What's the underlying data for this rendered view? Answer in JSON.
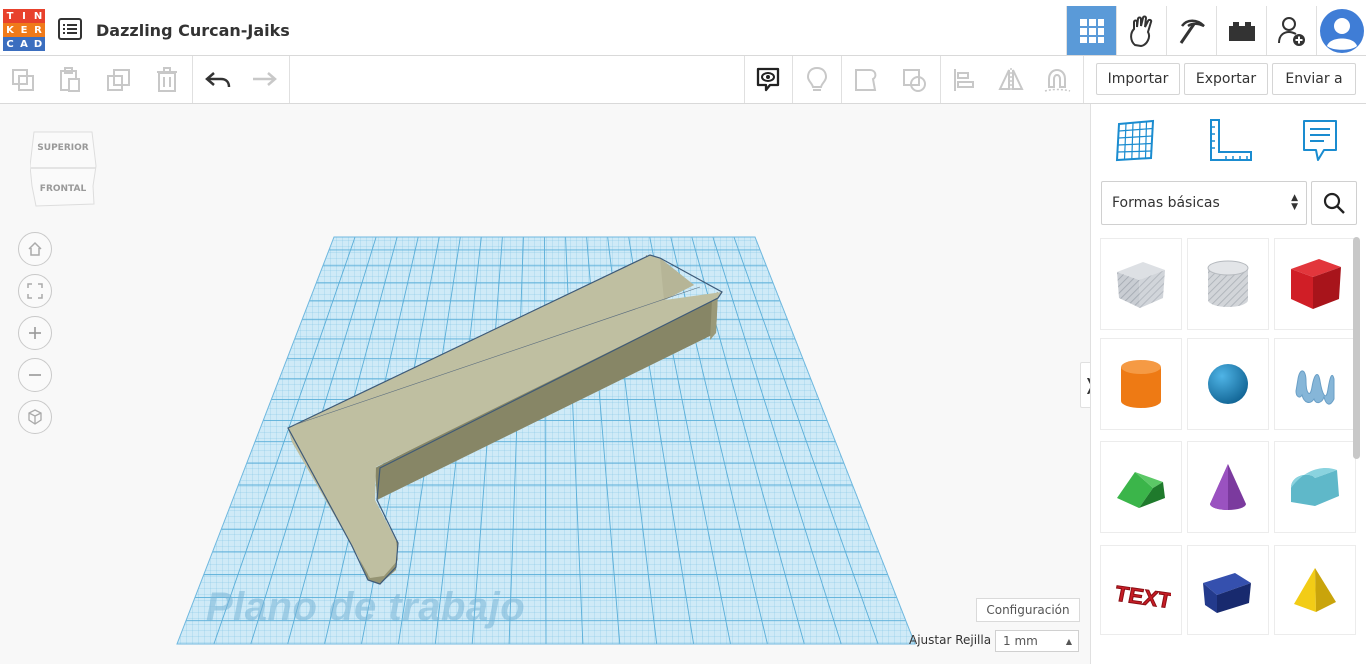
{
  "app": {
    "logo_letters": [
      "T",
      "I",
      "N",
      "K",
      "E",
      "R",
      "C",
      "A",
      "D"
    ],
    "logo_colors": [
      "#e8412c",
      "#e8412c",
      "#e8412c",
      "#f07a1a",
      "#f07a1a",
      "#f07a1a",
      "#3b6ebf",
      "#3b6ebf",
      "#3b6ebf"
    ],
    "project_title": "Dazzling Curcan-Jaiks"
  },
  "header": {
    "icons": [
      "grid-view-icon",
      "tinker-hand-icon",
      "pickaxe-icon",
      "bricks-icon",
      "add-user-icon",
      "user-avatar-icon"
    ],
    "active_icon": "grid-view-icon",
    "accent": "#5a9ad8"
  },
  "toolbar": {
    "import_label": "Importar",
    "export_label": "Exportar",
    "send_label": "Enviar a"
  },
  "viewcube": {
    "top_label": "SUPERIOR",
    "front_label": "FRONTAL"
  },
  "sidepanel": {
    "category_select": "Formas básicas",
    "shapes": [
      {
        "name": "box-hole-shape",
        "color": "#b8bec6"
      },
      {
        "name": "cylinder-hole-shape",
        "color": "#c4c8cd"
      },
      {
        "name": "box-shape",
        "color": "#d01e26"
      },
      {
        "name": "cylinder-shape",
        "color": "#ee7a14"
      },
      {
        "name": "sphere-shape",
        "color": "#1a8cc8"
      },
      {
        "name": "scribble-shape",
        "color": "#86b6d8"
      },
      {
        "name": "roof-shape",
        "color": "#2c9a3a"
      },
      {
        "name": "cone-shape",
        "color": "#7b3a9e"
      },
      {
        "name": "round-roof-shape",
        "color": "#5fb8c9"
      },
      {
        "name": "text-shape",
        "color": "#c71d26"
      },
      {
        "name": "wedge-shape",
        "color": "#233a8c"
      },
      {
        "name": "pyramid-shape",
        "color": "#f2cc16"
      }
    ]
  },
  "workplane": {
    "label": "Plano de trabajo",
    "settings_label": "Configuración",
    "snap_grid_label": "Ajustar Rejilla",
    "snap_grid_value": "1 mm"
  }
}
